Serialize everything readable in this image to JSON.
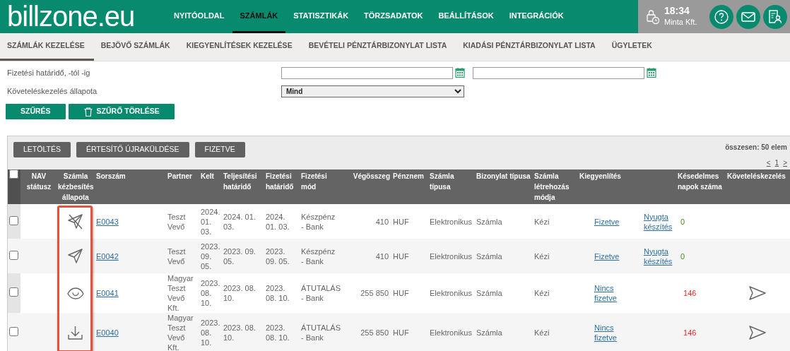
{
  "header": {
    "logo": "billzone.eu",
    "nav": [
      {
        "label": "NYITÓOLDAL",
        "selected": false
      },
      {
        "label": "SZÁMLÁK",
        "selected": true
      },
      {
        "label": "STATISZTIKÁK",
        "selected": false
      },
      {
        "label": "TÖRZSADATOK",
        "selected": false
      },
      {
        "label": "BEÁLLÍTÁSOK",
        "selected": false
      },
      {
        "label": "INTEGRÁCIÓK",
        "selected": false
      }
    ],
    "time": "18:34",
    "company": "Minta Kft."
  },
  "subnav": [
    {
      "label": "SZÁMLÁK KEZELÉSE",
      "selected": true
    },
    {
      "label": "BEJÖVŐ SZÁMLÁK",
      "selected": false
    },
    {
      "label": "KIEGYENLÍTÉSEK KEZELÉSE",
      "selected": false
    },
    {
      "label": "BEVÉTELI PÉNZTÁRBIZONYLAT LISTA",
      "selected": false
    },
    {
      "label": "KIADÁSI PÉNZTÁRBIZONYLAT LISTA",
      "selected": false
    },
    {
      "label": "ÜGYLETEK",
      "selected": false
    }
  ],
  "filters": [
    {
      "kind": "daterange",
      "label": "Fizetési határidő, -tól -ig"
    },
    {
      "kind": "select",
      "label": "Követeléskezelés állapota",
      "value": "Mind"
    }
  ],
  "filter_buttons": [
    {
      "kind": "plain",
      "label": "SZŰRÉS"
    },
    {
      "kind": "clear",
      "label": "SZŰRŐ TÖRLÉSE"
    }
  ],
  "actions": [
    "LETÖLTÉS",
    "ÉRTESÍTŐ ÚJRAKÜLDÉSE",
    "FIZETVE"
  ],
  "total": "összesen: 50 elem",
  "pagination": [
    "<",
    "1",
    ">"
  ],
  "table": {
    "select_all_checked": false,
    "columns": [
      {
        "label": "NAV státusz",
        "kind": "text",
        "highlighted": false
      },
      {
        "label": "Számla kézbesítés állapota",
        "kind": "text",
        "highlighted": true
      },
      {
        "label": "Sorszám",
        "kind": "text",
        "highlighted": false
      },
      {
        "label": "Partner",
        "kind": "text",
        "highlighted": false
      },
      {
        "label": "Kelt",
        "kind": "text",
        "highlighted": false
      },
      {
        "label": "Teljesítési határidő",
        "kind": "text",
        "highlighted": false
      },
      {
        "label": "Fizetési határidő",
        "kind": "text",
        "highlighted": false
      },
      {
        "label": "Fizetési mód",
        "kind": "text",
        "highlighted": false
      },
      {
        "label": "Végösszeg",
        "kind": "amount",
        "highlighted": false
      },
      {
        "label": "Pénznem",
        "kind": "text",
        "highlighted": false
      },
      {
        "label": "Számla típusa",
        "kind": "text",
        "highlighted": false
      },
      {
        "label": "Bizonylat típusa",
        "kind": "text",
        "highlighted": false
      },
      {
        "label": "Számla létrehozás módja",
        "kind": "text",
        "highlighted": false
      },
      {
        "label": "Kiegyenlítés",
        "kind": "settlement",
        "highlighted": false
      },
      {
        "label": "Késedelmes napok száma",
        "kind": "text",
        "highlighted": false
      },
      {
        "label": "Követeléskezelés",
        "kind": "text",
        "highlighted": false
      }
    ],
    "rows": [
      {
        "checked": false,
        "kind": "not_sent",
        "number": "E0043",
        "partner": "Teszt Vevő",
        "issued": "2024. 01. 03.",
        "performance": "2024. 01. 03.",
        "due": "2024. 01. 03.",
        "payment": "Készpénz - Bank",
        "total": "410",
        "currency": "HUF",
        "invoice_type": "Elektronikus",
        "document_type": "Számla",
        "creation": "Kézi",
        "settlement": "Fizetve",
        "receipt": "Nyugta készítés",
        "late_days": "0",
        "overdue": false,
        "collection_action": false
      },
      {
        "checked": false,
        "kind": "sent",
        "number": "E0042",
        "partner": "Teszt Vevő",
        "issued": "2023. 09. 05.",
        "performance": "2023. 09. 05.",
        "due": "2023. 09. 05.",
        "payment": "Készpénz - Bank",
        "total": "410",
        "currency": "HUF",
        "invoice_type": "Elektronikus",
        "document_type": "Számla",
        "creation": "Kézi",
        "settlement": "Fizetve",
        "receipt": "Nyugta készítés",
        "late_days": "0",
        "overdue": false,
        "collection_action": false
      },
      {
        "checked": false,
        "kind": "viewed",
        "number": "E0041",
        "partner": "Magyar Teszt Vevő Kft.",
        "issued": "2023. 08. 10.",
        "performance": "2023. 08. 10.",
        "due": "2023. 08. 10.",
        "payment": "ÁTUTALÁS - Bank",
        "total": "255 850",
        "currency": "HUF",
        "invoice_type": "Elektronikus",
        "document_type": "Számla",
        "creation": "Kézi",
        "settlement": "Nincs fizetve",
        "late_days": "146",
        "overdue": true,
        "collection_action": true
      },
      {
        "checked": false,
        "kind": "downloaded",
        "number": "E0040",
        "partner": "Magyar Teszt Vevő Kft.",
        "issued": "2023. 08. 10.",
        "performance": "2023. 08. 10.",
        "due": "2023. 08. 10.",
        "payment": "ÁTUTALÁS - Bank",
        "total": "255 850",
        "currency": "HUF",
        "invoice_type": "Elektronikus",
        "document_type": "Számla",
        "creation": "Kézi",
        "settlement": "Nincs fizetve",
        "late_days": "146",
        "overdue": true,
        "collection_action": true
      }
    ]
  }
}
